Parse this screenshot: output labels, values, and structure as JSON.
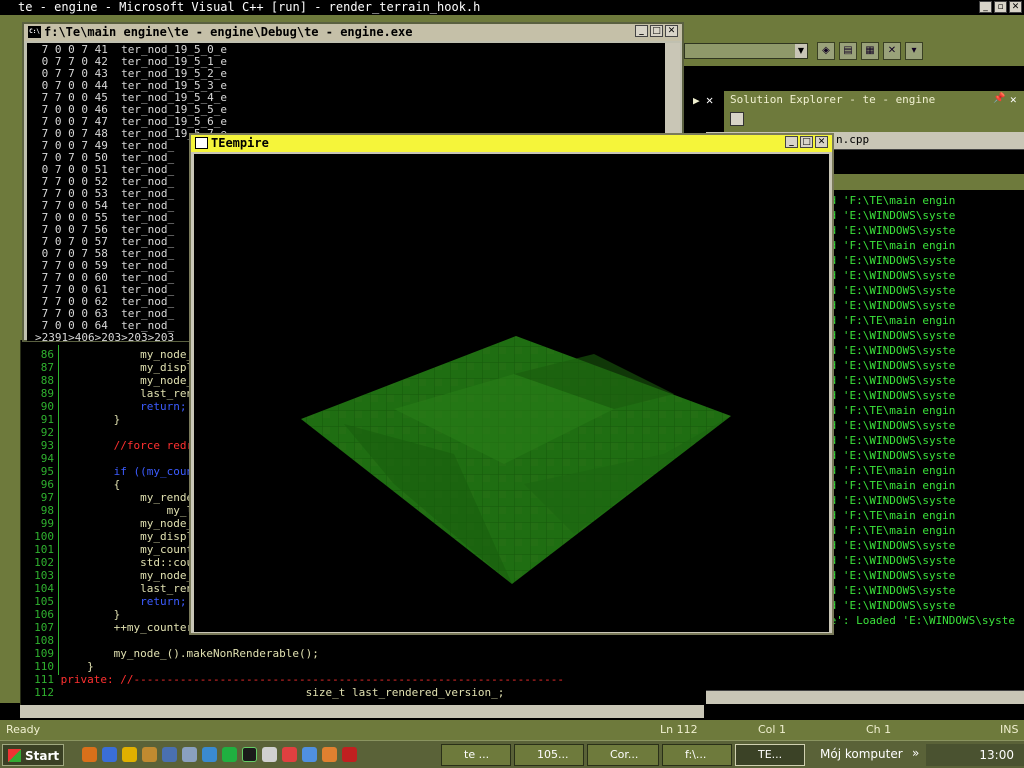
{
  "ide": {
    "title": "te  - engine - Microsoft Visual C++ [run] - render_terrain_hook.h",
    "solution_explorer_title": "Solution Explorer - te  - engine",
    "file_tab": "n.cpp",
    "code_lines": [
      {
        "num": "86",
        "text": "            my_node_()"
      },
      {
        "num": "87",
        "text": "            my_display"
      },
      {
        "num": "88",
        "text": "            my_node_()"
      },
      {
        "num": "89",
        "text": "            last_rende"
      },
      {
        "num": "90",
        "text": "            return;",
        "kw": true
      },
      {
        "num": "91",
        "text": "        }"
      },
      {
        "num": "92",
        "text": ""
      },
      {
        "num": "93",
        "text": "        //force redraw",
        "cm": true
      },
      {
        "num": "94",
        "text": ""
      },
      {
        "num": "95",
        "text": "        if ((my_counte",
        "kw": true
      },
      {
        "num": "96",
        "text": "        {"
      },
      {
        "num": "97",
        "text": "            my_rendere"
      },
      {
        "num": "98",
        "text": "                my_lon"
      },
      {
        "num": "99",
        "text": "            my_node_()"
      },
      {
        "num": "100",
        "text": "            my_display"
      },
      {
        "num": "101",
        "text": "            my_counter"
      },
      {
        "num": "102",
        "text": "            std::cout"
      },
      {
        "num": "103",
        "text": "            my_node_()"
      },
      {
        "num": "104",
        "text": "            last_rende"
      },
      {
        "num": "105",
        "text": "            return;",
        "kw": true
      },
      {
        "num": "106",
        "text": "        }"
      },
      {
        "num": "107",
        "text": "        ++my_counter_s"
      },
      {
        "num": "108",
        "text": ""
      },
      {
        "num": "109",
        "text": "        my_node_().makeNonRenderable();"
      },
      {
        "num": "110",
        "text": "    }"
      },
      {
        "num": "111",
        "text": "private: //-----------------------------------------------------------------",
        "private": true
      },
      {
        "num": "112",
        "text": "                                     size_t last_rendered_version_;"
      }
    ],
    "output_lines": [
      "e': Loaded 'F:\\TE\\main engin",
      "e': Loaded 'E:\\WINDOWS\\syste",
      "e': Loaded 'E:\\WINDOWS\\syste",
      "e': Loaded 'F:\\TE\\main engin",
      "e': Loaded 'E:\\WINDOWS\\syste",
      "e': Loaded 'E:\\WINDOWS\\syste",
      "e': Loaded 'E:\\WINDOWS\\syste",
      "e': Loaded 'E:\\WINDOWS\\syste",
      "e': Loaded 'F:\\TE\\main engin",
      "e': Loaded 'E:\\WINDOWS\\syste",
      "e': Loaded 'E:\\WINDOWS\\syste",
      "e': Loaded 'E:\\WINDOWS\\syste",
      "e': Loaded 'E:\\WINDOWS\\syste",
      "e': Loaded 'E:\\WINDOWS\\syste",
      "e': Loaded 'F:\\TE\\main engin",
      "e': Loaded 'E:\\WINDOWS\\syste",
      "e': Loaded 'E:\\WINDOWS\\syste",
      "e': Loaded 'E:\\WINDOWS\\syste",
      "e': Loaded 'F:\\TE\\main engin",
      "e': Loaded 'F:\\TE\\main engin",
      "e': Loaded 'E:\\WINDOWS\\syste",
      "e': Loaded 'F:\\TE\\main engin",
      "e': Loaded 'F:\\TE\\main engin",
      "e': Loaded 'E:\\WINDOWS\\syste",
      "e': Loaded 'E:\\WINDOWS\\syste",
      "e': Loaded 'E:\\WINDOWS\\syste",
      "e': Loaded 'E:\\WINDOWS\\syste",
      "e': Loaded 'E:\\WINDOWS\\syste",
      "engine.exe': Loaded 'E:\\WINDOWS\\syste"
    ],
    "status": {
      "ready": "Ready",
      "ln": "Ln 112",
      "col": "Col 1",
      "ch": "Ch 1",
      "ins": "INS"
    }
  },
  "console": {
    "title": "f:\\Te\\main engine\\te  - engine\\Debug\\te  - engine.exe",
    "lines": [
      " 7 0 0 7 41  ter_nod_19_5_0_e",
      " 0 7 7 0 42  ter_nod_19_5_1_e",
      " 0 7 7 0 43  ter_nod_19_5_2_e",
      " 0 7 0 0 44  ter_nod_19_5_3_e",
      " 7 7 0 0 45  ter_nod_19_5_4_e",
      " 7 0 0 0 46  ter_nod_19_5_5_e",
      " 7 0 0 7 47  ter_nod_19_5_6_e",
      " 7 0 0 7 48  ter_nod_19_5_7_e",
      " 7 0 0 7 49  ter_nod_",
      " 7 0 7 0 50  ter_nod_",
      " 0 7 0 0 51  ter_nod_",
      " 7 7 0 0 52  ter_nod_",
      " 7 7 0 0 53  ter_nod_",
      " 7 7 0 0 54  ter_nod_",
      " 7 0 0 0 55  ter_nod_",
      " 7 0 0 7 56  ter_nod_",
      " 7 0 7 0 57  ter_nod_",
      " 0 7 0 7 58  ter_nod_",
      " 7 7 0 0 59  ter_nod_",
      " 7 7 0 0 60  ter_nod_",
      " 7 7 0 0 61  ter_nod_",
      " 7 7 0 0 62  ter_nod_",
      " 7 7 0 0 63  ter_nod_",
      " 7 0 0 0 64  ter_nod_",
      ">2391>406>203>203>203"
    ]
  },
  "teempire": {
    "title": "TEempire"
  },
  "taskbar": {
    "start_label": "Start",
    "tasks": [
      "te ...",
      "105...",
      "Cor...",
      "f:\\...",
      "TE..."
    ],
    "mycomputer": "Mój komputer",
    "clock": "13:00"
  },
  "colors": {
    "accent": "#6e7a3c",
    "terrain": "#1f6e12"
  }
}
